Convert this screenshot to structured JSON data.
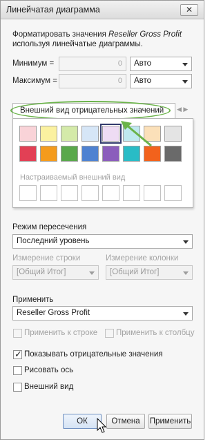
{
  "window": {
    "title": "Линейчатая диаграмма",
    "close_glyph": "✕"
  },
  "description": {
    "prefix": "Форматировать значения ",
    "measure": "Reseller Gross Profit",
    "suffix": " используя линейчатые диаграммы."
  },
  "minimum": {
    "label": "Минимум =",
    "value": "0",
    "mode": "Авто"
  },
  "maximum": {
    "label": "Максимум =",
    "value": "0",
    "mode": "Авто"
  },
  "palette": {
    "tab_label": "Внешний вид отрицательных значений",
    "row1": [
      "#f9d3d8",
      "#fbf1a0",
      "#d4eaa9",
      "#d6e6f7",
      "#eedcf4",
      "#bfe9ef",
      "#fbe0b9",
      "#e4e4e4"
    ],
    "row2": [
      "#e24055",
      "#f49b1d",
      "#59a84b",
      "#4f82d1",
      "#8b5dbc",
      "#29bcc6",
      "#f2621c",
      "#6a6a6a"
    ],
    "selected_index": 4,
    "custom_label": "Настраиваемый внешний вид",
    "custom_count": 8,
    "highlight_color": "#6bb34a"
  },
  "intersection": {
    "label": "Режим пересечения",
    "value": "Последний уровень"
  },
  "row_dim": {
    "label": "Измерение строки",
    "value": "[Общий Итог]"
  },
  "col_dim": {
    "label": "Измерение колонки",
    "value": "[Общий Итог]"
  },
  "apply": {
    "label": "Применить",
    "value": "Reseller Gross Profit"
  },
  "apply_row": {
    "label": "Применить к строке"
  },
  "apply_col": {
    "label": "Применить к столбцу"
  },
  "show_negative": {
    "label": "Показывать отрицательные значения",
    "checked": true
  },
  "draw_axis": {
    "label": "Рисовать ось",
    "checked": false
  },
  "appearance": {
    "label": "Внешний вид",
    "checked": false
  },
  "buttons": {
    "ok": "ОК",
    "cancel": "Отмена",
    "apply": "Применить"
  }
}
